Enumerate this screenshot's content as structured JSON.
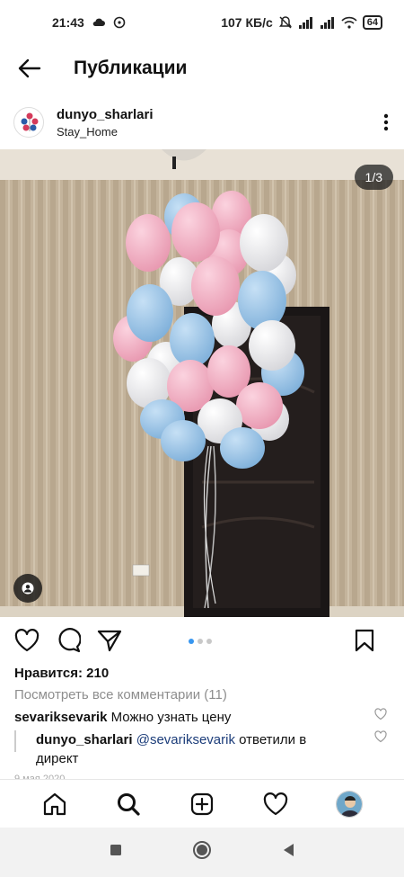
{
  "status_bar": {
    "time": "21:43",
    "network_speed": "107 КБ/с",
    "battery": "64"
  },
  "header": {
    "title": "Публикации"
  },
  "post": {
    "username": "dunyo_sharlari",
    "location": "Stay_Home",
    "image_counter": "1/3",
    "carousel": {
      "total": 3,
      "active_index": 0
    },
    "likes": "Нравится: 210",
    "view_comments": "Посмотреть все комментарии (11)",
    "comments": [
      {
        "author": "sevariksevarik",
        "text": "Можно узнать цену"
      }
    ],
    "reply": {
      "author": "dunyo_sharlari",
      "mention": "@sevariksevarik",
      "text_line1": "ответили в",
      "text_line2": "директ"
    },
    "date_partial": "9 мая 2020"
  },
  "icons": {
    "back": "arrow-left-icon",
    "more": "vertical-dots-icon",
    "like": "heart-icon",
    "comment": "speech-bubble-icon",
    "share": "paper-plane-icon",
    "save": "bookmark-icon",
    "home": "home-icon",
    "search": "search-icon",
    "add": "plus-square-icon",
    "activity": "heart-icon",
    "profile": "avatar-icon"
  },
  "colors": {
    "accent": "#3897f0",
    "muted": "#8e8e8e",
    "mention": "#1c3d7a"
  }
}
